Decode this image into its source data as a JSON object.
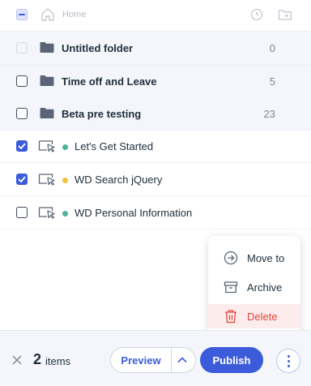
{
  "header": {
    "title": "Home",
    "icons": {
      "home": "home-icon",
      "recent": "clock-icon",
      "new_folder": "new-folder-icon"
    }
  },
  "folders": [
    {
      "name": "Untitled folder",
      "count": "0",
      "checked": false,
      "disabled": true
    },
    {
      "name": "Time off and Leave",
      "count": "5",
      "checked": false,
      "disabled": false
    },
    {
      "name": "Beta pre testing",
      "count": "23",
      "checked": false,
      "disabled": false
    }
  ],
  "items": [
    {
      "name": "Let's Get Started",
      "checked": true,
      "status_color": "#4ab59a"
    },
    {
      "name": "WD Search jQuery",
      "checked": true,
      "status_color": "#f0c236"
    },
    {
      "name": "WD Personal Information",
      "checked": false,
      "status_color": "#4ab59a"
    }
  ],
  "menu": {
    "move_to": "Move to",
    "archive": "Archive",
    "delete": "Delete"
  },
  "footer": {
    "count": "2",
    "items_label": "items",
    "preview": "Preview",
    "publish": "Publish"
  },
  "colors": {
    "accent": "#3b5bdb",
    "danger": "#e0443a",
    "folder_bg": "#f4f6fb"
  }
}
